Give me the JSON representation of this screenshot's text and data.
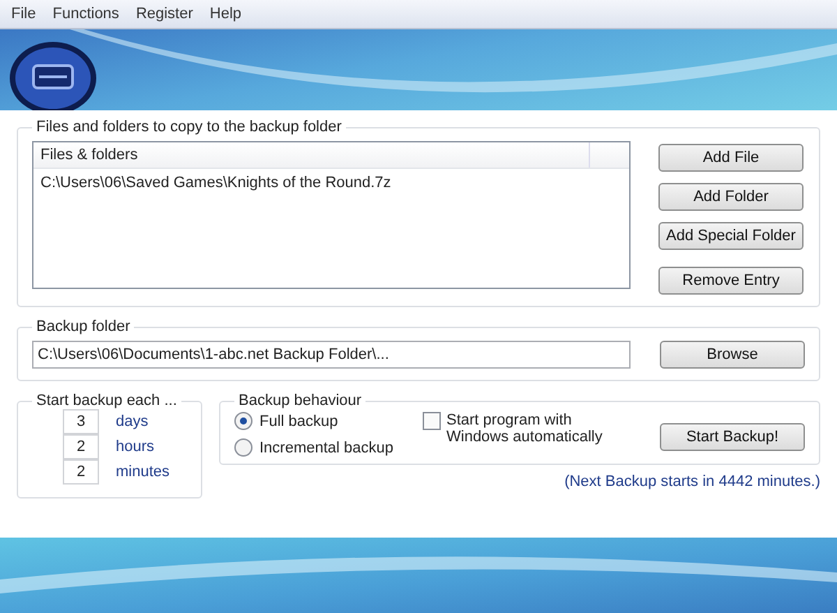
{
  "menu": [
    "File",
    "Functions",
    "Register",
    "Help"
  ],
  "files_group": {
    "title": "Files and folders to copy to the backup folder",
    "column": "Files & folders",
    "rows": [
      "C:\\Users\\06\\Saved Games\\Knights of the Round.7z"
    ],
    "buttons": [
      "Add File",
      "Add Folder",
      "Add Special Folder",
      "Remove Entry"
    ]
  },
  "backup_folder": {
    "title": "Backup folder",
    "value": "C:\\Users\\06\\Documents\\1-abc.net Backup Folder\\...",
    "button": "Browse"
  },
  "schedule": {
    "title": "Start backup each ...",
    "fields": [
      {
        "value": "3",
        "unit": "days"
      },
      {
        "value": "2",
        "unit": "hours"
      },
      {
        "value": "2",
        "unit": "minutes"
      }
    ]
  },
  "behaviour": {
    "title": "Backup behaviour",
    "options": [
      {
        "label": "Full backup",
        "selected": true
      },
      {
        "label": "Incremental backup",
        "selected": false
      }
    ],
    "autostart": {
      "label": "Start program with Windows automatically",
      "checked": false
    },
    "button": "Start Backup!"
  },
  "status": "(Next Backup starts in 4442 minutes.)"
}
